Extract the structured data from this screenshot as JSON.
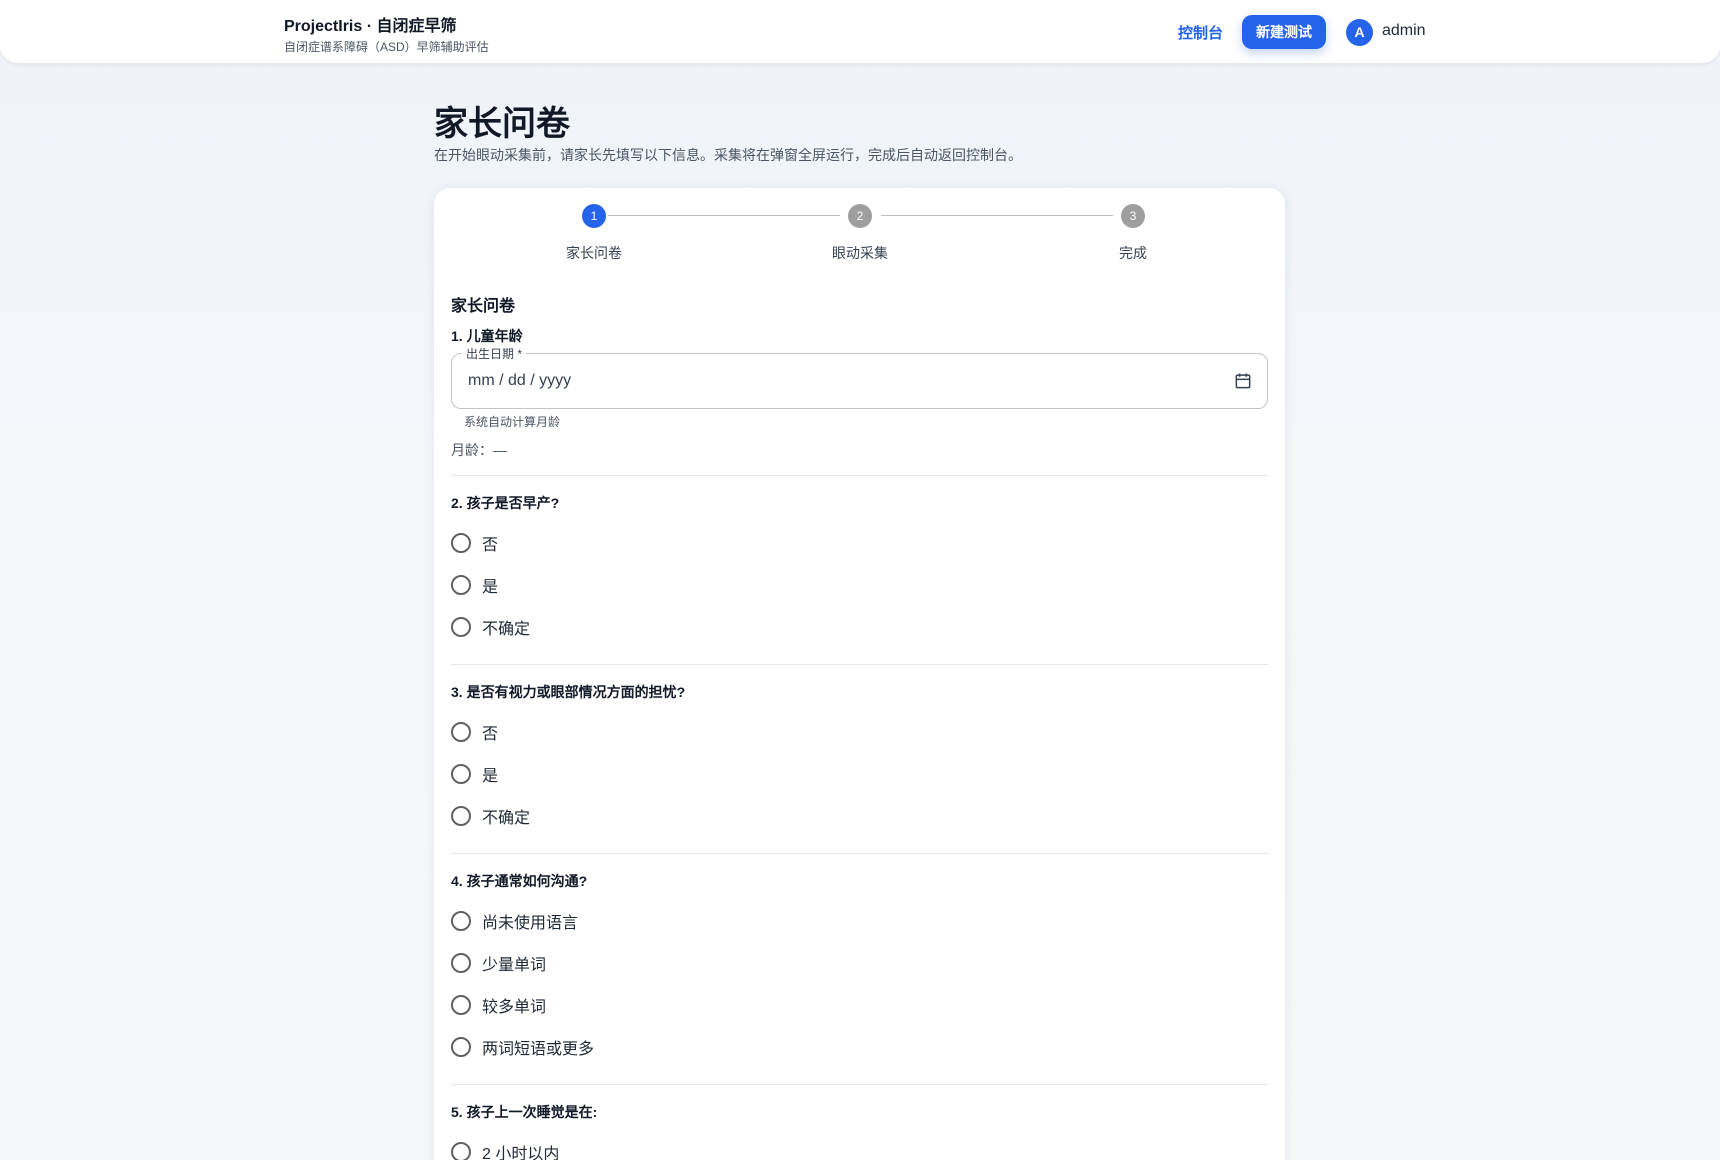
{
  "header": {
    "brand_title": "ProjectIris · 自闭症早筛",
    "brand_subtitle": "自闭症谱系障碍（ASD）早筛辅助评估",
    "nav_dashboard": "控制台",
    "new_test_label": "新建测试",
    "avatar_letter": "A",
    "username": "admin"
  },
  "page": {
    "title": "家长问卷",
    "description": "在开始眼动采集前，请家长先填写以下信息。采集将在弹窗全屏运行，完成后自动返回控制台。"
  },
  "stepper": {
    "active_step": 1,
    "steps": [
      {
        "number": "1",
        "label": "家长问卷"
      },
      {
        "number": "2",
        "label": "眼动采集"
      },
      {
        "number": "3",
        "label": "完成"
      }
    ]
  },
  "form": {
    "section_title": "家长问卷",
    "q1": {
      "title": "1. 儿童年龄",
      "field_label": "出生日期 *",
      "placeholder": "mm / dd / yyyy",
      "helper": "系统自动计算月龄",
      "age_text": "月龄：—"
    },
    "q2": {
      "title": "2. 孩子是否早产?",
      "options": [
        "否",
        "是",
        "不确定"
      ]
    },
    "q3": {
      "title": "3. 是否有视力或眼部情况方面的担忧?",
      "options": [
        "否",
        "是",
        "不确定"
      ]
    },
    "q4": {
      "title": "4. 孩子通常如何沟通?",
      "options": [
        "尚未使用语言",
        "少量单词",
        "较多单词",
        "两词短语或更多"
      ]
    },
    "q5": {
      "title": "5. 孩子上一次睡觉是在:",
      "options": [
        "2 小时以内"
      ]
    }
  },
  "colors": {
    "accent": "#2563eb",
    "step_inactive": "#9e9e9e",
    "radio_border": "#616161"
  },
  "icons": [
    "calendar-icon"
  ]
}
